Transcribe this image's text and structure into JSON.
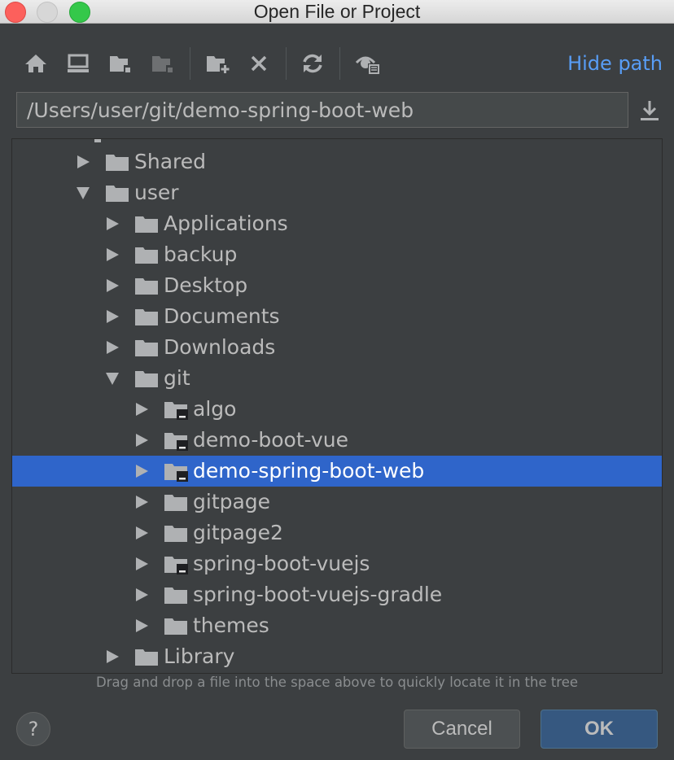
{
  "window": {
    "title": "Open File or Project"
  },
  "toolbar": {
    "buttons": [
      {
        "name": "home-icon"
      },
      {
        "name": "desktop-icon"
      },
      {
        "name": "project-folder-icon"
      },
      {
        "name": "module-folder-icon"
      },
      {
        "name": "new-folder-icon"
      },
      {
        "name": "delete-icon"
      },
      {
        "name": "refresh-icon"
      },
      {
        "name": "show-hidden-icon"
      }
    ],
    "hide_path_label": "Hide path"
  },
  "path": {
    "value": "/Users/user/git/demo-spring-boot-web"
  },
  "tree": {
    "items": [
      {
        "label": "Shared",
        "depth": 0,
        "expanded": false,
        "vcs": false,
        "selected": false
      },
      {
        "label": "user",
        "depth": 0,
        "expanded": true,
        "vcs": false,
        "selected": false
      },
      {
        "label": "Applications",
        "depth": 1,
        "expanded": false,
        "vcs": false,
        "selected": false
      },
      {
        "label": "backup",
        "depth": 1,
        "expanded": false,
        "vcs": false,
        "selected": false
      },
      {
        "label": "Desktop",
        "depth": 1,
        "expanded": false,
        "vcs": false,
        "selected": false
      },
      {
        "label": "Documents",
        "depth": 1,
        "expanded": false,
        "vcs": false,
        "selected": false
      },
      {
        "label": "Downloads",
        "depth": 1,
        "expanded": false,
        "vcs": false,
        "selected": false
      },
      {
        "label": "git",
        "depth": 1,
        "expanded": true,
        "vcs": false,
        "selected": false
      },
      {
        "label": "algo",
        "depth": 2,
        "expanded": false,
        "vcs": true,
        "selected": false
      },
      {
        "label": "demo-boot-vue",
        "depth": 2,
        "expanded": false,
        "vcs": true,
        "selected": false
      },
      {
        "label": "demo-spring-boot-web",
        "depth": 2,
        "expanded": false,
        "vcs": true,
        "selected": true
      },
      {
        "label": "gitpage",
        "depth": 2,
        "expanded": false,
        "vcs": false,
        "selected": false
      },
      {
        "label": "gitpage2",
        "depth": 2,
        "expanded": false,
        "vcs": false,
        "selected": false
      },
      {
        "label": "spring-boot-vuejs",
        "depth": 2,
        "expanded": false,
        "vcs": true,
        "selected": false
      },
      {
        "label": "spring-boot-vuejs-gradle",
        "depth": 2,
        "expanded": false,
        "vcs": false,
        "selected": false
      },
      {
        "label": "themes",
        "depth": 2,
        "expanded": false,
        "vcs": false,
        "selected": false
      },
      {
        "label": "Library",
        "depth": 1,
        "expanded": false,
        "vcs": false,
        "selected": false
      }
    ]
  },
  "hint": "Drag and drop a file into the space above to quickly locate it in the tree",
  "footer": {
    "help_label": "?",
    "cancel_label": "Cancel",
    "ok_label": "OK"
  },
  "colors": {
    "background": "#3c3f41",
    "selection": "#2f65ca",
    "link": "#589df6",
    "icon": "#afb1b3"
  }
}
